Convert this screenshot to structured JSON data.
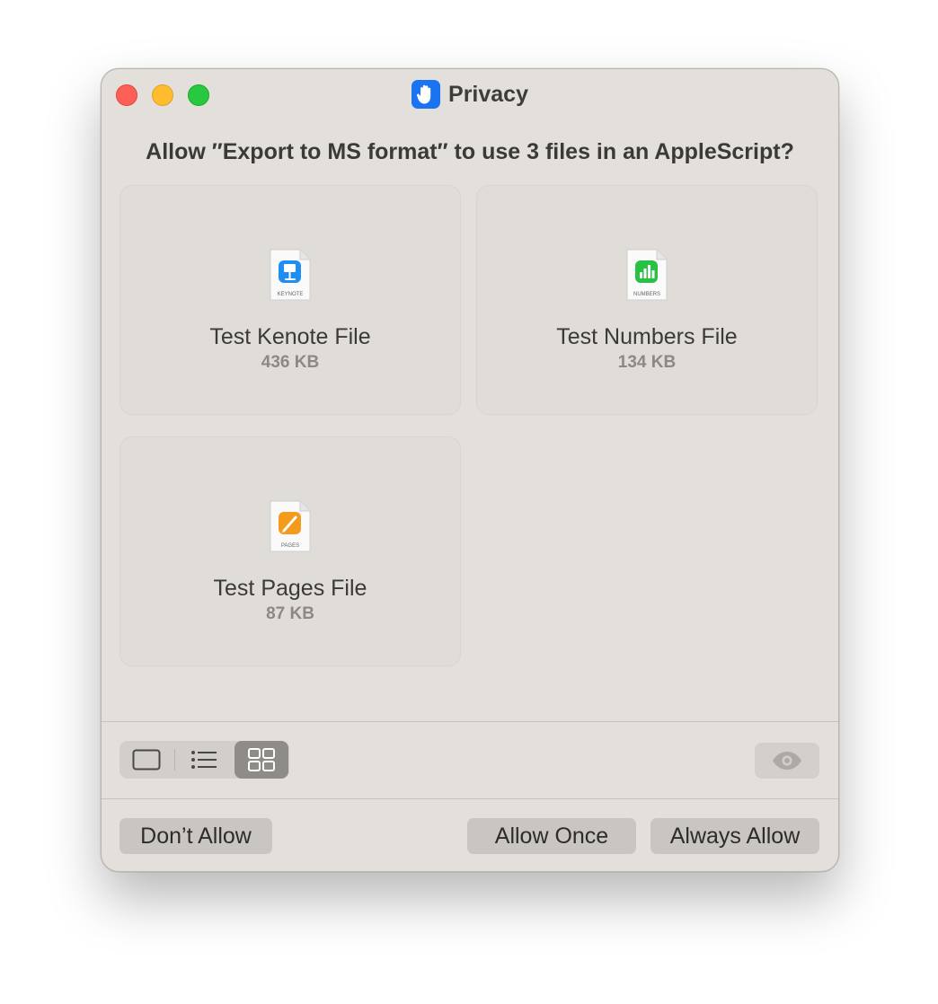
{
  "window": {
    "title": "Privacy",
    "title_icon": "raised-hand-icon",
    "accent": "#1a73f0"
  },
  "prompt": {
    "question": "Allow ″Export to MS format″ to use 3 files in an AppleScript?"
  },
  "files": [
    {
      "name": "Test Kenote File",
      "size": "436 KB",
      "icon": "keynote-document-icon",
      "type_label": "KEYNOTE",
      "color": "#1e8ef3"
    },
    {
      "name": "Test Numbers File",
      "size": "134 KB",
      "icon": "numbers-document-icon",
      "type_label": "NUMBERS",
      "color": "#27c244"
    },
    {
      "name": "Test Pages File",
      "size": "87 KB",
      "icon": "pages-document-icon",
      "type_label": "PAGES",
      "color": "#f59b1c"
    }
  ],
  "view_modes": {
    "selected": "grid",
    "options": [
      "single",
      "list",
      "grid"
    ]
  },
  "buttons": {
    "dont_allow": "Don’t Allow",
    "allow_once": "Allow Once",
    "always_allow": "Always Allow"
  }
}
